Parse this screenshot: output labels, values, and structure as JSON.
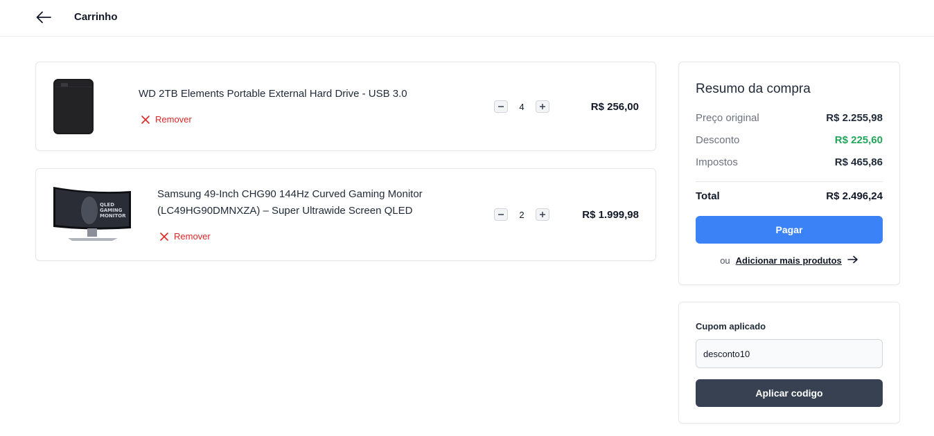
{
  "header": {
    "back_icon": "arrow-left-icon",
    "title": "Carrinho"
  },
  "cart": {
    "items": [
      {
        "name": "WD 2TB Elements Portable External Hard Drive - USB 3.0",
        "remove_label": "Remover",
        "quantity": "4",
        "price": "R$ 256,00"
      },
      {
        "name_line1": "Samsung 49-Inch CHG90 144Hz Curved Gaming Monitor",
        "name_line2": "(LC49HG90DMNXZA) – Super Ultrawide Screen QLED",
        "remove_label": "Remover",
        "quantity": "2",
        "price": "R$ 1.999,98",
        "image_text_1": "QLED",
        "image_text_2": "GAMING",
        "image_text_3": "MONITOR"
      }
    ]
  },
  "summary": {
    "title": "Resumo da compra",
    "original_label": "Preço original",
    "original_value": "R$ 2.255,98",
    "discount_label": "Desconto",
    "discount_value": "R$ 225,60",
    "taxes_label": "Impostos",
    "taxes_value": "R$ 465,86",
    "total_label": "Total",
    "total_value": "R$ 2.496,24",
    "pay_label": "Pagar",
    "or_label": "ou",
    "add_more_label": "Adicionar mais produtos"
  },
  "coupon": {
    "label": "Cupom aplicado",
    "value": "desconto10",
    "apply_label": "Aplicar codigo"
  },
  "colors": {
    "primary": "#3b82f6",
    "dark_button": "#374151",
    "discount_green": "#22a55a",
    "remove_red": "#dc2626"
  }
}
